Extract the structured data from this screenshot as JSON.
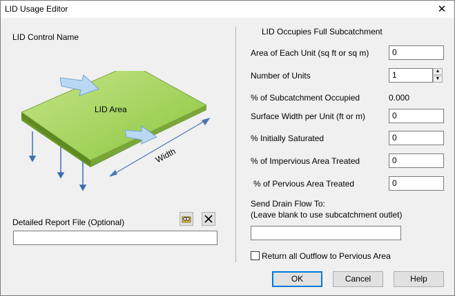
{
  "window": {
    "title": "LID Usage Editor"
  },
  "left": {
    "lid_control_label": "LID Control Name",
    "diagram": {
      "area_label": "LID Area",
      "width_label": "Width"
    },
    "report_label": "Detailed Report File (Optional)",
    "report_value": ""
  },
  "right": {
    "header": "LID Occupies Full Subcatchment",
    "area_label": "Area of Each Unit (sq ft or sq m)",
    "area_value": "0",
    "units_label": "Number of Units",
    "units_value": "1",
    "occupied_label": "% of Subcatchment Occupied",
    "occupied_value": "0.000",
    "width_label": "Surface Width per Unit (ft or m)",
    "width_value": "0",
    "saturated_label": "% Initially Saturated",
    "saturated_value": "0",
    "impervious_label": "% of Impervious Area Treated",
    "impervious_value": "0",
    "pervious_label": "% of Pervious Area Treated",
    "pervious_value": "0",
    "drain_label_1": "Send Drain Flow To:",
    "drain_label_2": "(Leave blank to use subcatchment outlet)",
    "drain_value": "",
    "return_label": "Return all Outflow to Pervious Area"
  },
  "buttons": {
    "ok": "OK",
    "cancel": "Cancel",
    "help": "Help"
  },
  "icons": {
    "close": "close-icon",
    "browse": "browse-folder-icon",
    "clear": "clear-x-icon"
  },
  "colors": {
    "lid_green": "#a8d65c",
    "arrow_blue": "#5b8fc9",
    "focus_blue": "#0078d7"
  }
}
